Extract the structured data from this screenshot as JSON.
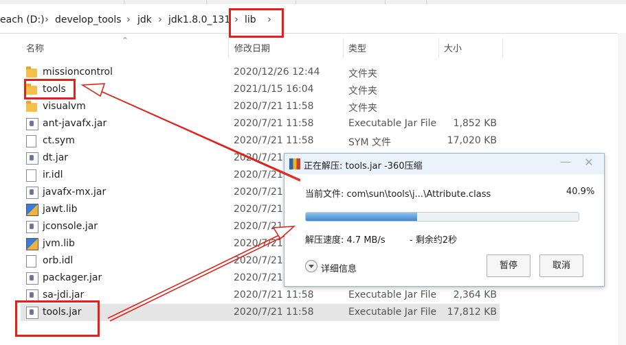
{
  "breadcrumb": {
    "items": [
      "each (D:)",
      "develop_tools",
      "jdk",
      "jdk1.8.0_131",
      "lib"
    ],
    "separator": "›"
  },
  "columns": {
    "name": "名称",
    "date": "修改日期",
    "type": "类型",
    "size": "大小"
  },
  "files": [
    {
      "name": "missioncontrol",
      "icon": "folder-icon",
      "date": "2020/12/26 12:44",
      "type": "文件夹",
      "size": ""
    },
    {
      "name": "tools",
      "icon": "folder-icon",
      "date": "2021/1/15 16:04",
      "type": "文件夹",
      "size": ""
    },
    {
      "name": "visualvm",
      "icon": "folder-icon",
      "date": "2020/7/21 11:58",
      "type": "文件夹",
      "size": ""
    },
    {
      "name": "ant-javafx.jar",
      "icon": "jar-file-icon",
      "date": "2020/7/21 11:58",
      "type": "Executable Jar File",
      "size": "1,852 KB"
    },
    {
      "name": "ct.sym",
      "icon": "document-icon",
      "date": "2020/7/21 11:58",
      "type": "SYM 文件",
      "size": "17,020 KB"
    },
    {
      "name": "dt.jar",
      "icon": "jar-file-icon",
      "date": "2020/7/21",
      "type": "",
      "size": ""
    },
    {
      "name": "ir.idl",
      "icon": "document-icon",
      "date": "2020/7/21",
      "type": "",
      "size": ""
    },
    {
      "name": "javafx-mx.jar",
      "icon": "jar-file-icon",
      "date": "2020/7/21",
      "type": "",
      "size": ""
    },
    {
      "name": "jawt.lib",
      "icon": "lib-file-icon",
      "date": "2020/7/21",
      "type": "",
      "size": ""
    },
    {
      "name": "jconsole.jar",
      "icon": "jar-file-icon",
      "date": "2020/7/21",
      "type": "",
      "size": ""
    },
    {
      "name": "jvm.lib",
      "icon": "lib-file-icon",
      "date": "2020/7/21",
      "type": "",
      "size": ""
    },
    {
      "name": "orb.idl",
      "icon": "document-icon",
      "date": "2020/7/21",
      "type": "",
      "size": ""
    },
    {
      "name": "packager.jar",
      "icon": "jar-file-icon",
      "date": "2020/7/21",
      "type": "",
      "size": ""
    },
    {
      "name": "sa-jdi.jar",
      "icon": "jar-file-icon",
      "date": "2020/7/21 11:58",
      "type": "Executable Jar File",
      "size": "2,364 KB"
    },
    {
      "name": "tools.jar",
      "icon": "jar-file-icon",
      "date": "2020/7/21 11:58",
      "type": "Executable Jar File",
      "size": "17,812 KB",
      "selected": true
    }
  ],
  "dialog": {
    "title": "正在解压: tools.jar -360压缩",
    "current_file": "当前文件: com\\sun\\tools\\j...\\Attribute.class",
    "percent": "40.9%",
    "progress_fraction": 0.409,
    "speed": "解压速度: 4.7 MB/s",
    "remaining": "- 剩余约2秒",
    "details_label": "详细信息",
    "pause_label": "暂停",
    "cancel_label": "取消",
    "minimize_glyph": "—",
    "close_glyph": "✕"
  },
  "colors": {
    "highlight": "#e0221b",
    "selection": "#e5e5e5",
    "progress": "#3f86cf"
  }
}
